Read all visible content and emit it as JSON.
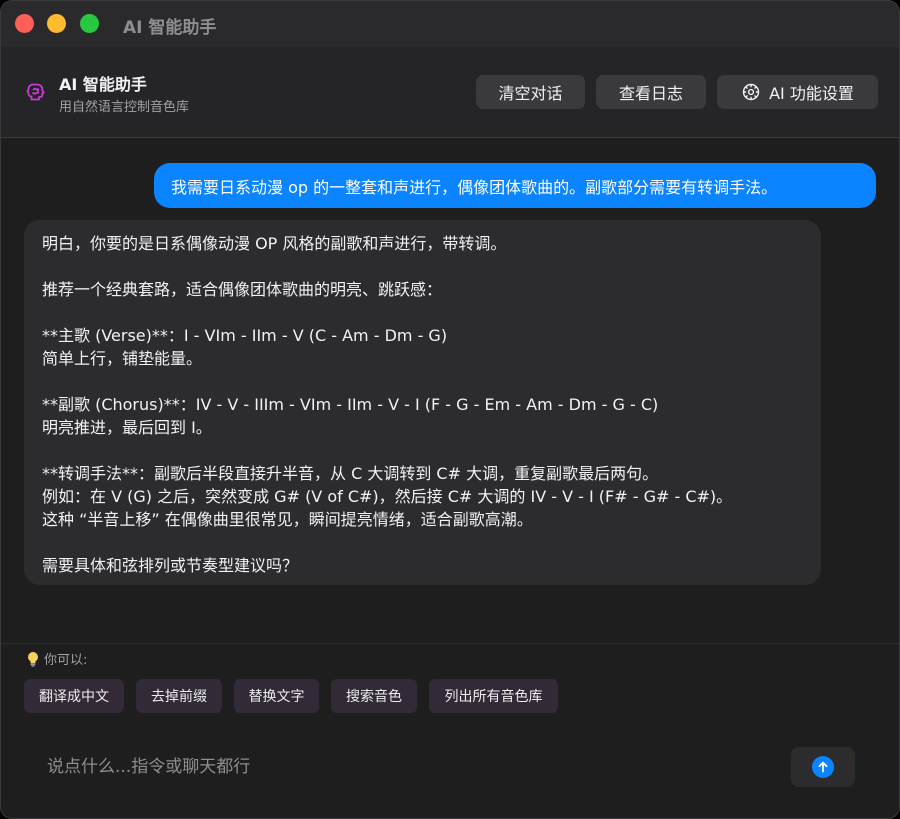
{
  "window": {
    "title": "AI 智能助手"
  },
  "header": {
    "app_name": "AI 智能助手",
    "subtitle": "用自然语言控制音色库",
    "buttons": {
      "clear": "清空对话",
      "logs": "查看日志",
      "settings": "AI 功能设置"
    }
  },
  "chat": {
    "user_message": "我需要日系动漫 op 的一整套和声进行，偶像团体歌曲的。副歌部分需要有转调手法。",
    "assistant_message": {
      "lines": [
        "明白，你要的是日系偶像动漫 OP 风格的副歌和声进行，带转调。",
        "",
        "推荐一个经典套路，适合偶像团体歌曲的明亮、跳跃感：",
        "",
        "**主歌 (Verse)**：I - VIm - IIm - V (C - Am - Dm - G)",
        "简单上行，铺垫能量。",
        "",
        "**副歌 (Chorus)**：IV - V - IIIm - VIm - IIm - V - I (F - G - Em - Am - Dm - G - C)",
        "明亮推进，最后回到 I。",
        "",
        "**转调手法**：副歌后半段直接升半音，从 C 大调转到 C# 大调，重复副歌最后两句。",
        "例如：在 V (G) 之后，突然变成 G# (V of C#)，然后接 C# 大调的 IV - V - I (F# - G# - C#)。",
        "这种 “半音上移” 在偶像曲里很常见，瞬间提亮情绪，适合副歌高潮。",
        "",
        "需要具体和弦排列或节奏型建议吗？"
      ]
    }
  },
  "suggestions": {
    "hint": "你可以:",
    "chips": [
      "翻译成中文",
      "去掉前缀",
      "替换文字",
      "搜索音色",
      "列出所有音色库"
    ]
  },
  "input": {
    "placeholder": "说点什么...指令或聊天都行",
    "value": ""
  },
  "icons": {
    "brain": "brain-icon",
    "gear": "gear-icon",
    "bulb": "lightbulb-icon",
    "send": "arrow-up-icon"
  },
  "colors": {
    "accent": "#0a84ff",
    "brain_icon": "#c93ad6",
    "chip_bg": "#322a36"
  }
}
